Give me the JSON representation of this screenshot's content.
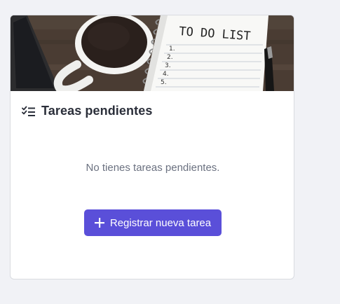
{
  "card": {
    "banner_text": "TO DO LIST",
    "banner_icon": "todo-notebook-coffee-image",
    "title_icon": "checklist-icon",
    "title": "Tareas pendientes",
    "empty_message": "No tienes tareas pendientes.",
    "action_icon": "plus-icon",
    "action_label": "Registrar nueva tarea"
  },
  "colors": {
    "background": "#f1f2f6",
    "card": "#ffffff",
    "primary": "#5a4fd9",
    "title": "#2b2f3a",
    "muted": "#6b7180"
  }
}
